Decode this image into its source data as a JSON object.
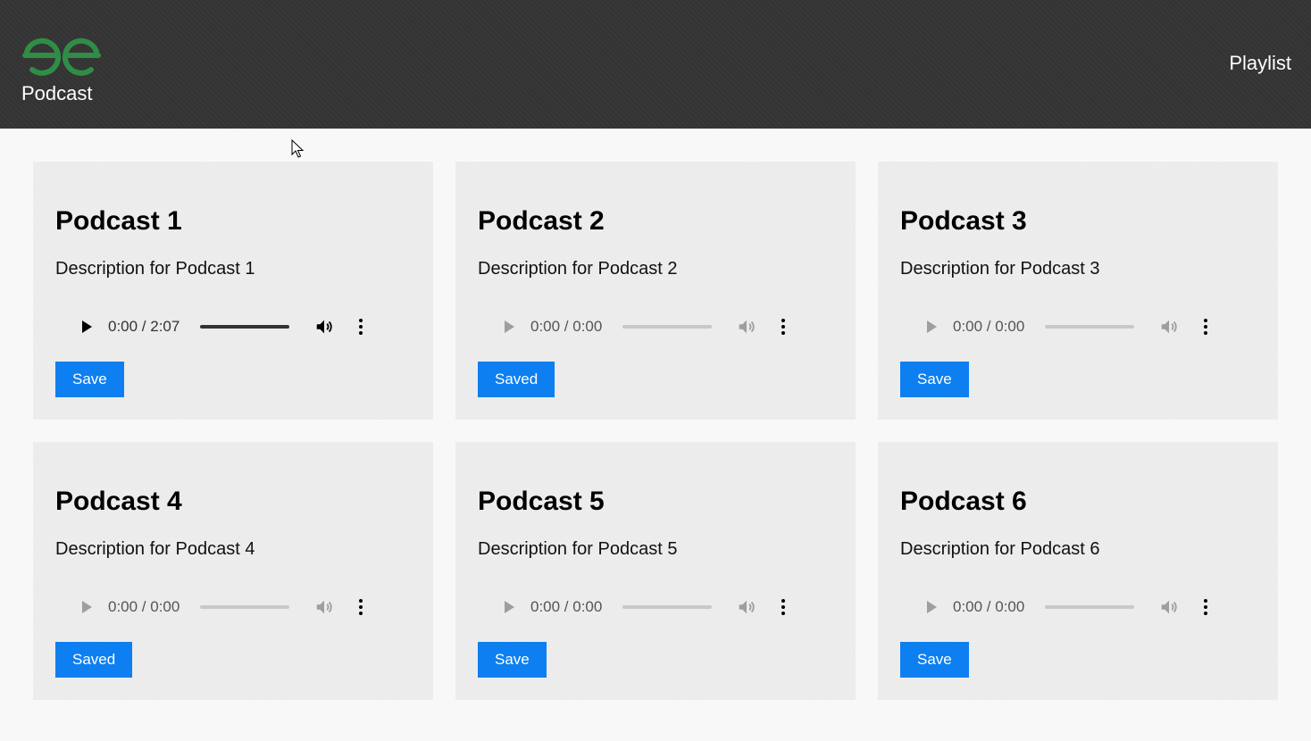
{
  "header": {
    "brand_text": "Podcast",
    "playlist_label": "Playlist",
    "logo_icon": "geeksforgeeks-logo-icon",
    "logo_color": "#2f8d46",
    "background": "#333333"
  },
  "colors": {
    "button": "#0d7ff0",
    "card_background": "#ebebeb",
    "page_background": "#f8f8f8"
  },
  "podcasts": [
    {
      "title": "Podcast 1",
      "description": "Description for Podcast 1",
      "time": "0:00 / 2:07",
      "progress": 1.0,
      "loaded": true,
      "button_label": "Save"
    },
    {
      "title": "Podcast 2",
      "description": "Description for Podcast 2",
      "time": "0:00 / 0:00",
      "progress": 0,
      "loaded": false,
      "button_label": "Saved"
    },
    {
      "title": "Podcast 3",
      "description": "Description for Podcast 3",
      "time": "0:00 / 0:00",
      "progress": 0,
      "loaded": false,
      "button_label": "Save"
    },
    {
      "title": "Podcast 4",
      "description": "Description for Podcast 4",
      "time": "0:00 / 0:00",
      "progress": 0,
      "loaded": false,
      "button_label": "Saved"
    },
    {
      "title": "Podcast 5",
      "description": "Description for Podcast 5",
      "time": "0:00 / 0:00",
      "progress": 0,
      "loaded": false,
      "button_label": "Save"
    },
    {
      "title": "Podcast 6",
      "description": "Description for Podcast 6",
      "time": "0:00 / 0:00",
      "progress": 0,
      "loaded": false,
      "button_label": "Save"
    }
  ]
}
